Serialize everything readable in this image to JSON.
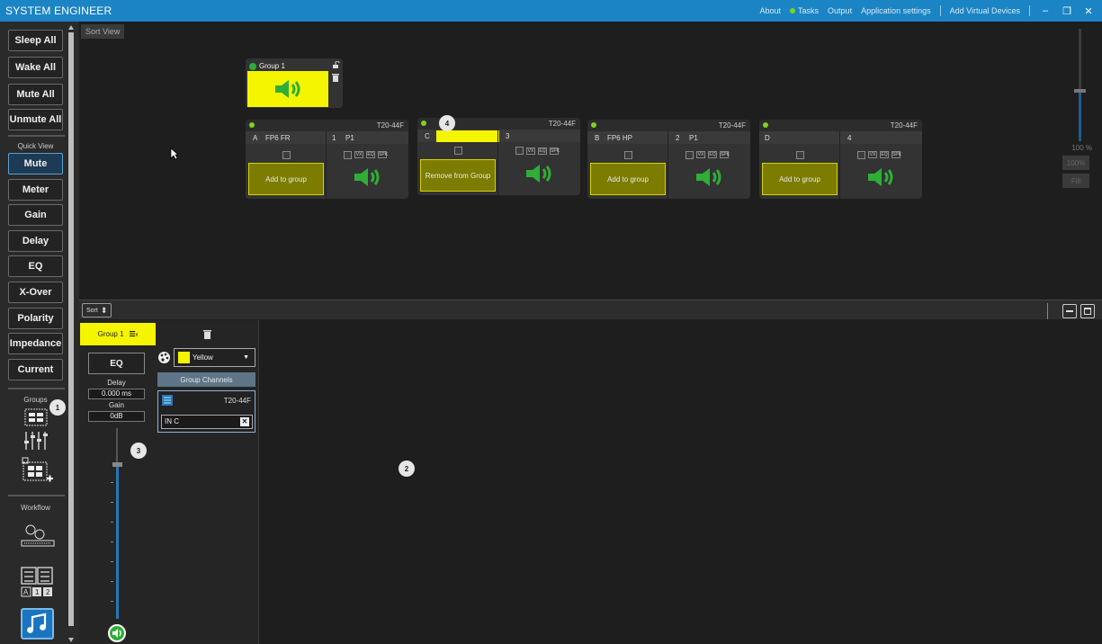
{
  "titlebar": {
    "app_title": "SYSTEM ENGINEER",
    "menu": [
      "About",
      "Tasks",
      "Output",
      "Application settings",
      "Add Virtual Devices"
    ],
    "window_controls": [
      "minimize-icon",
      "restore-icon",
      "close-icon"
    ]
  },
  "sidebar": {
    "commands": [
      "Sleep All",
      "Wake All",
      "Mute All",
      "Unmute All"
    ],
    "quick_view_label": "Quick View",
    "views": [
      "Mute",
      "Meter",
      "Gain",
      "Delay",
      "EQ",
      "X-Over",
      "Polarity",
      "Impedance",
      "Current"
    ],
    "active_view": "Mute",
    "groups_label": "Groups",
    "workflow_label": "Workflow"
  },
  "canvas": {
    "sort_view_label": "Sort View",
    "zoom": {
      "percent_label": "100 %",
      "btn_100": "100%",
      "btn_fill": "Fill"
    },
    "group_card": {
      "name": "Group 1"
    },
    "devices": [
      {
        "model": "T20-44F",
        "ch_letter": "A",
        "ch_name": "FP6 FR",
        "out_num": "1",
        "out_name": "P1",
        "button": "Add to group"
      },
      {
        "model": "T20-44F",
        "ch_letter": "C",
        "ch_name": "",
        "out_num": "3",
        "out_name": "",
        "button": "Remove from Group"
      },
      {
        "model": "T20-44F",
        "ch_letter": "B",
        "ch_name": "FP6 HP",
        "out_num": "2",
        "out_name": "P1",
        "button": "Add to group"
      },
      {
        "model": "T20-44F",
        "ch_letter": "D",
        "ch_name": "",
        "out_num": "4",
        "out_name": "",
        "button": "Add to group"
      }
    ],
    "mini_buttons": [
      "VX",
      "EQ",
      "SPK"
    ]
  },
  "bottom_bar": {
    "sort_label": "Sort"
  },
  "group_panel": {
    "tab_label": "Group 1",
    "eq_label": "EQ",
    "delay_label": "Delay",
    "delay_value": "0.000 ms",
    "gain_label": "Gain",
    "gain_value": "0dB",
    "color_name": "Yellow",
    "group_channels_label": "Group Channels",
    "channel_model": "T20-44F",
    "channel_name": "IN C"
  },
  "callouts": [
    "1",
    "2",
    "3",
    "4"
  ],
  "colors": {
    "titlebar": "#1b84c4",
    "group_yellow": "#f5f500",
    "active_green": "#2fae37",
    "accent_blue": "#2477b7"
  }
}
